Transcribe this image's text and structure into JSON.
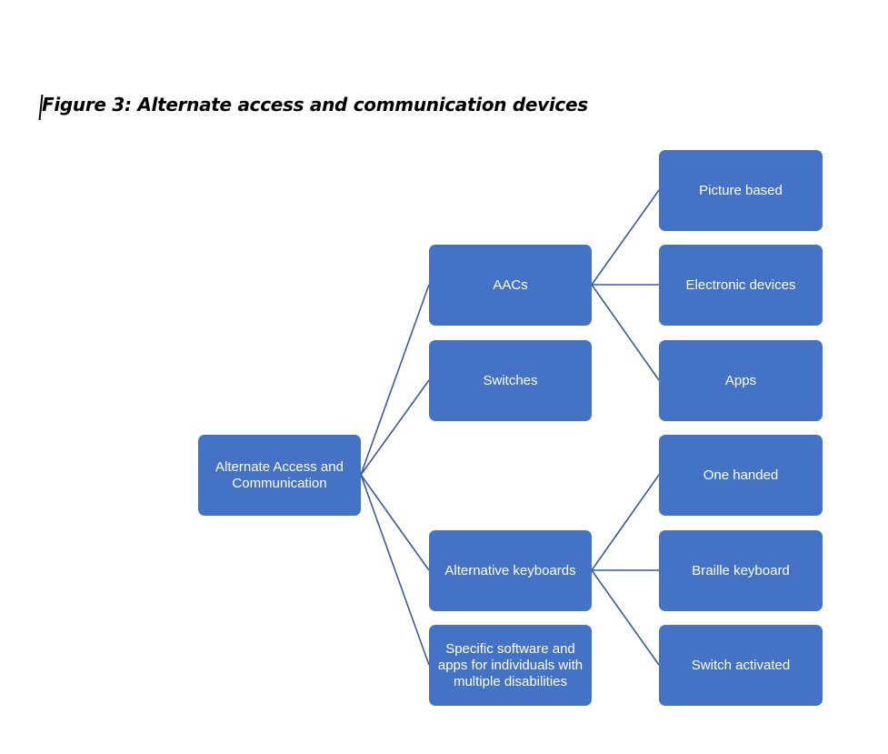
{
  "title": "Figure 3: Alternate access and communication devices",
  "colors": {
    "node_fill": "#4472C4",
    "node_text": "#ffffff",
    "connector": "#3A5A9B"
  },
  "root": {
    "label": "Alternate Access and Communication"
  },
  "level1": [
    {
      "id": "aacs",
      "label": "AACs",
      "children": [
        "Picture based",
        "Electronic devices",
        "Apps"
      ]
    },
    {
      "id": "switches",
      "label": "Switches",
      "children": []
    },
    {
      "id": "alt-keyboards",
      "label": "Alternative keyboards",
      "children": [
        "One handed",
        "Braille keyboard",
        "Switch activated"
      ]
    },
    {
      "id": "specific-software",
      "label": "Specific software and apps for individuals with multiple disabilities",
      "children": []
    }
  ],
  "level2": [
    {
      "label": "Picture based",
      "parent": "AACs"
    },
    {
      "label": "Electronic devices",
      "parent": "AACs"
    },
    {
      "label": "Apps",
      "parent": "AACs"
    },
    {
      "label": "One handed",
      "parent": "Alternative keyboards"
    },
    {
      "label": "Braille keyboard",
      "parent": "Alternative keyboards"
    },
    {
      "label": "Switch activated",
      "parent": "Alternative keyboards"
    }
  ]
}
